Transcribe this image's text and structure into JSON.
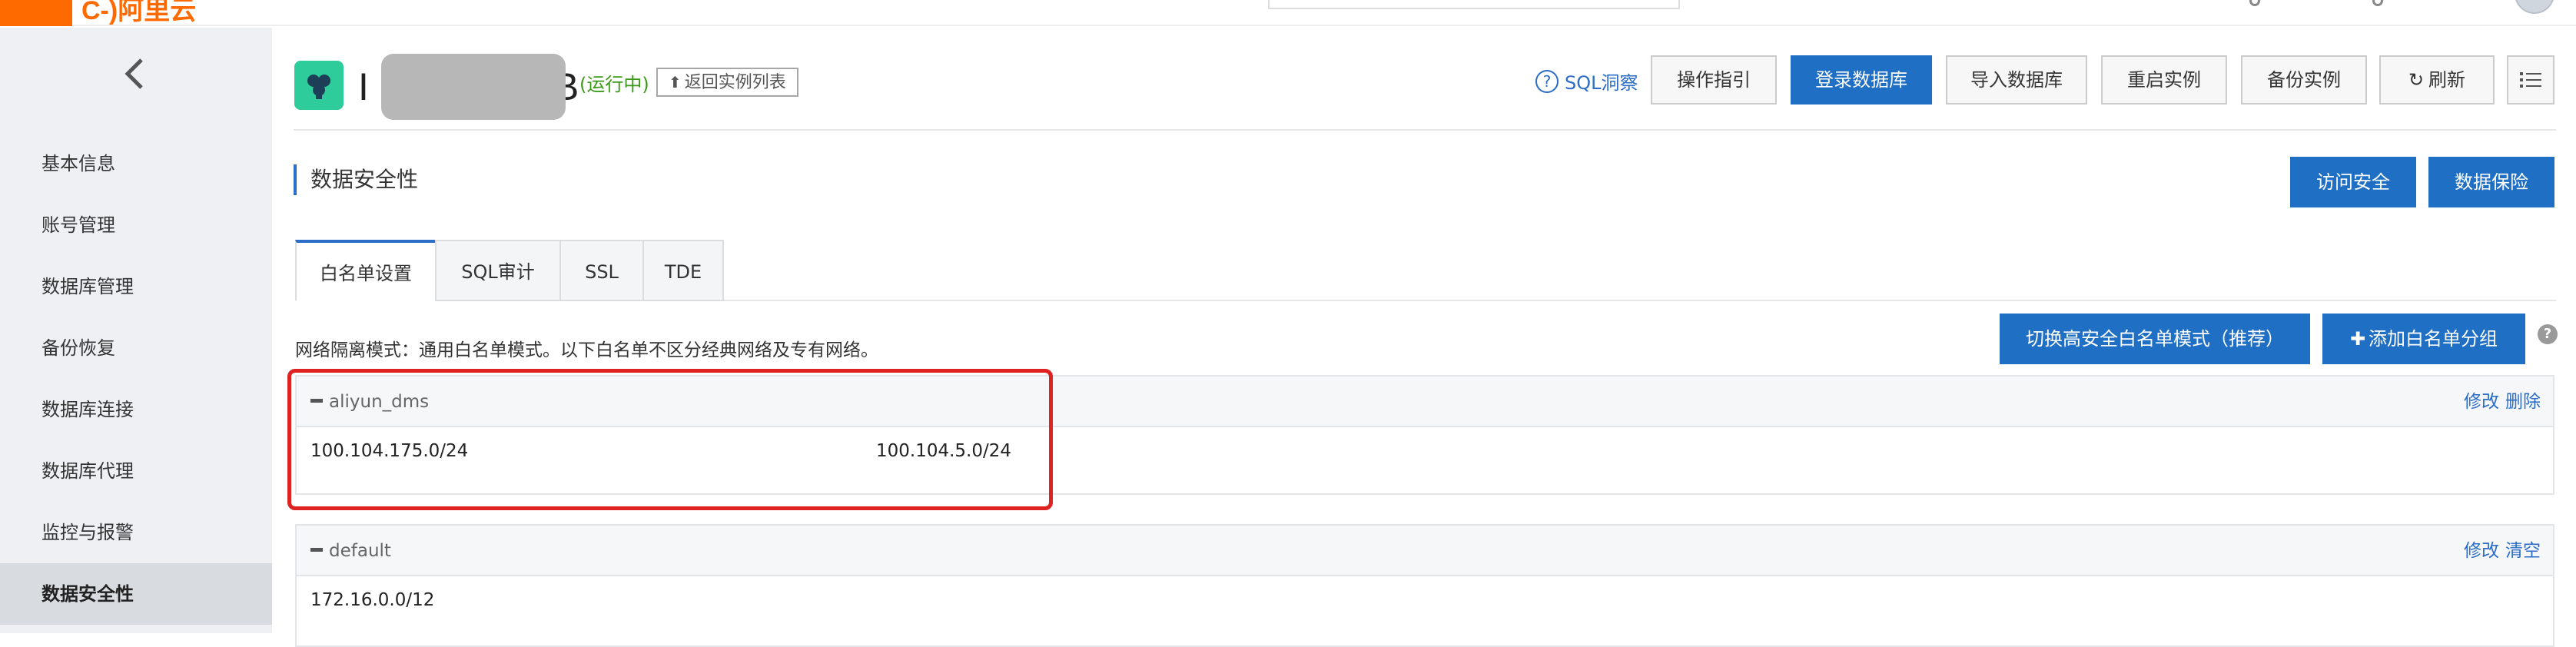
{
  "topbar": {
    "logo_text": "C-)阿里云"
  },
  "sidebar": {
    "items": [
      {
        "label": "基本信息"
      },
      {
        "label": "账号管理"
      },
      {
        "label": "数据库管理"
      },
      {
        "label": "备份恢复"
      },
      {
        "label": "数据库连接"
      },
      {
        "label": "数据库代理"
      },
      {
        "label": "监控与报警"
      },
      {
        "label": "数据安全性",
        "active": true
      }
    ]
  },
  "header": {
    "instance_name_suffix": "B",
    "instance_name_prefix": "I",
    "status": "(运行中)",
    "back_to_list": "返回实例列表",
    "sql_insight": "SQL洞察",
    "buttons": {
      "guide": "操作指引",
      "login_db": "登录数据库",
      "import_db": "导入数据库",
      "restart": "重启实例",
      "backup": "备份实例",
      "refresh": "刷新"
    }
  },
  "section": {
    "title": "数据安全性",
    "access_security": "访问安全",
    "data_protection": "数据保险"
  },
  "tabs": [
    {
      "label": "白名单设置",
      "active": true
    },
    {
      "label": "SQL审计"
    },
    {
      "label": "SSL"
    },
    {
      "label": "TDE"
    }
  ],
  "whitelist": {
    "mode_desc": "网络隔离模式：通用白名单模式。以下白名单不区分经典网络及专有网络。",
    "switch_mode_button": "切换高安全白名单模式（推荐）",
    "add_group_button": "添加白名单分组",
    "groups": [
      {
        "name": "aliyun_dms",
        "ips": [
          "100.104.175.0/24",
          "100.104.5.0/24"
        ],
        "action1": "修改",
        "action2": "删除"
      },
      {
        "name": "default",
        "ips": [
          "172.16.0.0/12"
        ],
        "action1": "修改",
        "action2": "清空"
      }
    ]
  },
  "colors": {
    "brand": "#ff6a00",
    "primary": "#1f6fc5",
    "link": "#2b6dc7",
    "status_running": "#3c9a1a",
    "highlight": "#dd2222"
  },
  "icons": {
    "back": "chevron-left-icon",
    "instance": "database-instance-icon",
    "help": "question-circle-icon",
    "refresh": "refresh-icon",
    "list": "list-icon"
  }
}
